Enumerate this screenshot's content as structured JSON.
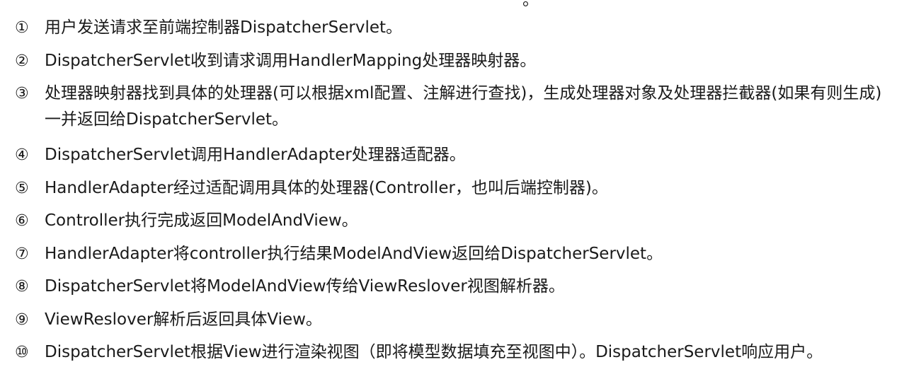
{
  "top_fragment": "。",
  "steps": [
    {
      "marker": "①",
      "text": "用户发送请求至前端控制器DispatcherServlet。"
    },
    {
      "marker": "②",
      "text": "DispatcherServlet收到请求调用HandlerMapping处理器映射器。"
    },
    {
      "marker": "③",
      "text": "处理器映射器找到具体的处理器(可以根据xml配置、注解进行查找)，生成处理器对象及处理器拦截器(如果有则生成)一并返回给DispatcherServlet。"
    },
    {
      "marker": "④",
      "text": "DispatcherServlet调用HandlerAdapter处理器适配器。"
    },
    {
      "marker": "⑤",
      "text": "HandlerAdapter经过适配调用具体的处理器(Controller，也叫后端控制器)。"
    },
    {
      "marker": "⑥",
      "text": "Controller执行完成返回ModelAndView。"
    },
    {
      "marker": "⑦",
      "text": "HandlerAdapter将controller执行结果ModelAndView返回给DispatcherServlet。"
    },
    {
      "marker": "⑧",
      "text": "DispatcherServlet将ModelAndView传给ViewReslover视图解析器。"
    },
    {
      "marker": "⑨",
      "text": "ViewReslover解析后返回具体View。"
    },
    {
      "marker": "⑩",
      "text": "DispatcherServlet根据View进行渲染视图（即将模型数据填充至视图中）。DispatcherServlet响应用户。"
    }
  ]
}
